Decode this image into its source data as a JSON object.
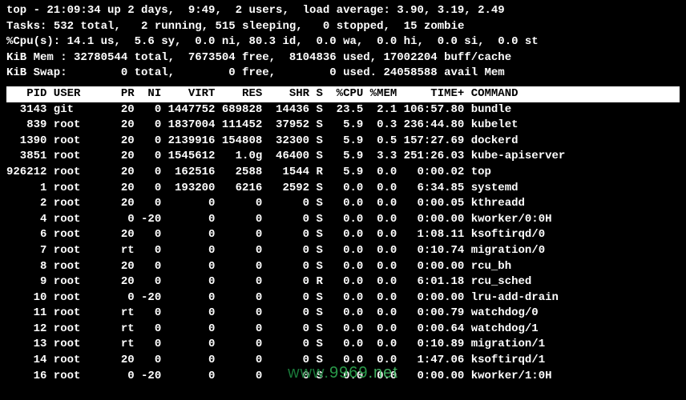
{
  "summary": {
    "line1": "top - 21:09:34 up 2 days,  9:49,  2 users,  load average: 3.90, 3.19, 2.49",
    "line2_a": "Tasks: ",
    "line2_b": "532 ",
    "line2_c": "total,   ",
    "line2_d": "2 ",
    "line2_e": "running, ",
    "line2_f": "515 ",
    "line2_g": "sleeping,   ",
    "line2_h": "0 ",
    "line2_i": "stopped,  ",
    "line2_j": "15 ",
    "line2_k": "zombie",
    "line3": "%Cpu(s): 14.1 us,  5.6 sy,  0.0 ni, 80.3 id,  0.0 wa,  0.0 hi,  0.0 si,  0.0 st",
    "line4": "KiB Mem : 32780544 total,  7673504 free,  8104836 used, 17002204 buff/cache",
    "line5": "KiB Swap:        0 total,        0 free,        0 used. 24058588 avail Mem"
  },
  "header": "   PID USER      PR  NI    VIRT    RES    SHR S  %CPU %MEM     TIME+ COMMAND        ",
  "processes": [
    {
      "pid": "3143",
      "user": "git",
      "pr": "20",
      "ni": "0",
      "virt": "1447752",
      "res": "689828",
      "shr": "14436",
      "s": "S",
      "cpu": "23.5",
      "mem": "2.1",
      "time": "106:57.80",
      "cmd": "bundle",
      "hl": false
    },
    {
      "pid": "839",
      "user": "root",
      "pr": "20",
      "ni": "0",
      "virt": "1837004",
      "res": "111452",
      "shr": "37952",
      "s": "S",
      "cpu": "5.9",
      "mem": "0.3",
      "time": "236:44.80",
      "cmd": "kubelet",
      "hl": false
    },
    {
      "pid": "1390",
      "user": "root",
      "pr": "20",
      "ni": "0",
      "virt": "2139916",
      "res": "154808",
      "shr": "32300",
      "s": "S",
      "cpu": "5.9",
      "mem": "0.5",
      "time": "157:27.69",
      "cmd": "dockerd",
      "hl": false
    },
    {
      "pid": "3851",
      "user": "root",
      "pr": "20",
      "ni": "0",
      "virt": "1545612",
      "res": "1.0g",
      "shr": "46400",
      "s": "S",
      "cpu": "5.9",
      "mem": "3.3",
      "time": "251:26.03",
      "cmd": "kube-apiserver",
      "hl": false
    },
    {
      "pid": "926212",
      "user": "root",
      "pr": "20",
      "ni": "0",
      "virt": "162516",
      "res": "2588",
      "shr": "1544",
      "s": "R",
      "cpu": "5.9",
      "mem": "0.0",
      "time": "0:00.02",
      "cmd": "top",
      "hl": true
    },
    {
      "pid": "1",
      "user": "root",
      "pr": "20",
      "ni": "0",
      "virt": "193200",
      "res": "6216",
      "shr": "2592",
      "s": "S",
      "cpu": "0.0",
      "mem": "0.0",
      "time": "6:34.85",
      "cmd": "systemd",
      "hl": false
    },
    {
      "pid": "2",
      "user": "root",
      "pr": "20",
      "ni": "0",
      "virt": "0",
      "res": "0",
      "shr": "0",
      "s": "S",
      "cpu": "0.0",
      "mem": "0.0",
      "time": "0:00.05",
      "cmd": "kthreadd",
      "hl": false
    },
    {
      "pid": "4",
      "user": "root",
      "pr": "0",
      "ni": "-20",
      "virt": "0",
      "res": "0",
      "shr": "0",
      "s": "S",
      "cpu": "0.0",
      "mem": "0.0",
      "time": "0:00.00",
      "cmd": "kworker/0:0H",
      "hl": false
    },
    {
      "pid": "6",
      "user": "root",
      "pr": "20",
      "ni": "0",
      "virt": "0",
      "res": "0",
      "shr": "0",
      "s": "S",
      "cpu": "0.0",
      "mem": "0.0",
      "time": "1:08.11",
      "cmd": "ksoftirqd/0",
      "hl": false
    },
    {
      "pid": "7",
      "user": "root",
      "pr": "rt",
      "ni": "0",
      "virt": "0",
      "res": "0",
      "shr": "0",
      "s": "S",
      "cpu": "0.0",
      "mem": "0.0",
      "time": "0:10.74",
      "cmd": "migration/0",
      "hl": false
    },
    {
      "pid": "8",
      "user": "root",
      "pr": "20",
      "ni": "0",
      "virt": "0",
      "res": "0",
      "shr": "0",
      "s": "S",
      "cpu": "0.0",
      "mem": "0.0",
      "time": "0:00.00",
      "cmd": "rcu_bh",
      "hl": false
    },
    {
      "pid": "9",
      "user": "root",
      "pr": "20",
      "ni": "0",
      "virt": "0",
      "res": "0",
      "shr": "0",
      "s": "R",
      "cpu": "0.0",
      "mem": "0.0",
      "time": "6:01.18",
      "cmd": "rcu_sched",
      "hl": true
    },
    {
      "pid": "10",
      "user": "root",
      "pr": "0",
      "ni": "-20",
      "virt": "0",
      "res": "0",
      "shr": "0",
      "s": "S",
      "cpu": "0.0",
      "mem": "0.0",
      "time": "0:00.00",
      "cmd": "lru-add-drain",
      "hl": false
    },
    {
      "pid": "11",
      "user": "root",
      "pr": "rt",
      "ni": "0",
      "virt": "0",
      "res": "0",
      "shr": "0",
      "s": "S",
      "cpu": "0.0",
      "mem": "0.0",
      "time": "0:00.79",
      "cmd": "watchdog/0",
      "hl": false
    },
    {
      "pid": "12",
      "user": "root",
      "pr": "rt",
      "ni": "0",
      "virt": "0",
      "res": "0",
      "shr": "0",
      "s": "S",
      "cpu": "0.0",
      "mem": "0.0",
      "time": "0:00.64",
      "cmd": "watchdog/1",
      "hl": false
    },
    {
      "pid": "13",
      "user": "root",
      "pr": "rt",
      "ni": "0",
      "virt": "0",
      "res": "0",
      "shr": "0",
      "s": "S",
      "cpu": "0.0",
      "mem": "0.0",
      "time": "0:10.89",
      "cmd": "migration/1",
      "hl": false
    },
    {
      "pid": "14",
      "user": "root",
      "pr": "20",
      "ni": "0",
      "virt": "0",
      "res": "0",
      "shr": "0",
      "s": "S",
      "cpu": "0.0",
      "mem": "0.0",
      "time": "1:47.06",
      "cmd": "ksoftirqd/1",
      "hl": false
    },
    {
      "pid": "16",
      "user": "root",
      "pr": "0",
      "ni": "-20",
      "virt": "0",
      "res": "0",
      "shr": "0",
      "s": "S",
      "cpu": "0.0",
      "mem": "0.0",
      "time": "0:00.00",
      "cmd": "kworker/1:0H",
      "hl": false
    }
  ],
  "watermark": {
    "p1": "www.",
    "p2": "9969",
    "p3": ".net"
  }
}
